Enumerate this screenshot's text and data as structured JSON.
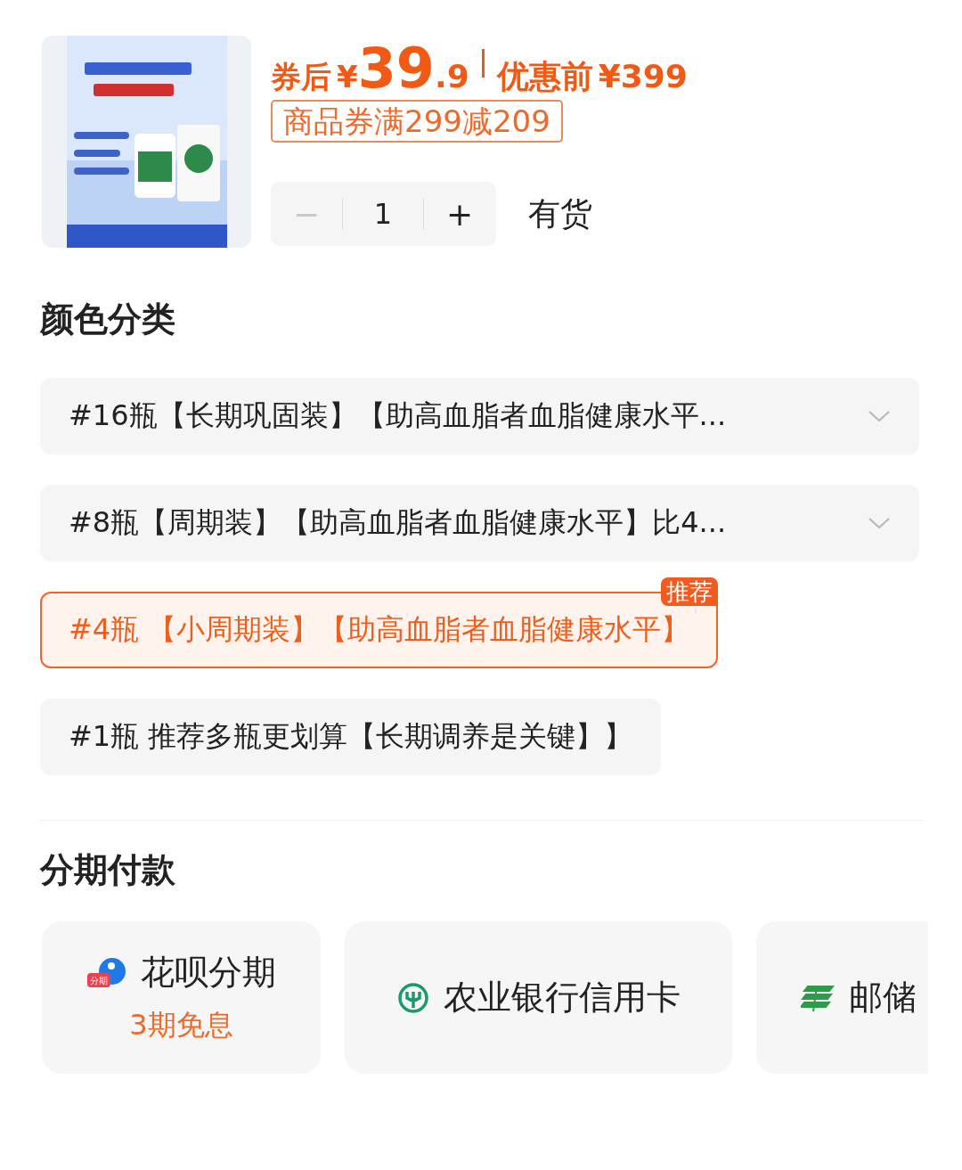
{
  "product": {
    "price": {
      "label": "券后",
      "currency": "¥",
      "integer": "39",
      "decimal": ".9",
      "original_label": "优惠前",
      "original_price": "¥399"
    },
    "coupon": "商品券满299减209",
    "quantity": {
      "minus": "−",
      "value": "1",
      "plus": "+",
      "minus_disabled": true
    },
    "stock": "有货"
  },
  "color_section": {
    "title": "颜色分类",
    "options": [
      {
        "label": "#16瓶【长期巩固装】【助高血脂者血脂健康水平...",
        "selected": false,
        "kind": "expandable"
      },
      {
        "label": "#8瓶【周期装】【助高血脂者血脂健康水平】比4...",
        "selected": false,
        "kind": "expandable"
      },
      {
        "label": "#4瓶 【小周期装】【助高血脂者血脂健康水平】",
        "selected": true,
        "kind": "plain",
        "badge": "推荐"
      },
      {
        "label": "#1瓶 推荐多瓶更划算【长期调养是关键】】",
        "selected": false,
        "kind": "plain"
      }
    ]
  },
  "installment_section": {
    "title": "分期付款",
    "methods": [
      {
        "kind": "huabei",
        "name": "花呗分期",
        "icon_badge": "分期",
        "subtitle": "3期免息"
      },
      {
        "kind": "abc",
        "name": "农业银行信用卡"
      },
      {
        "kind": "postal",
        "name": "邮储"
      }
    ]
  }
}
